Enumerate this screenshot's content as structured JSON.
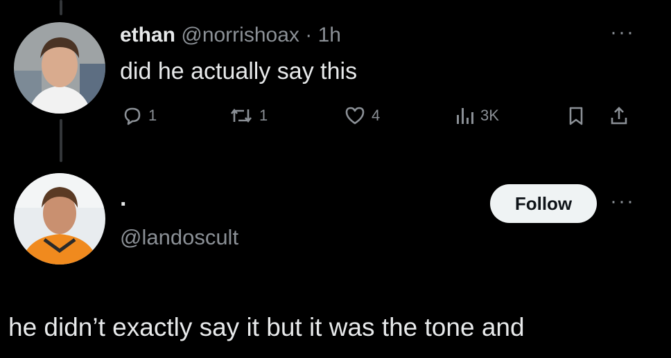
{
  "tweet": {
    "display_name": "ethan",
    "handle": "@norrishoax",
    "separator": " · ",
    "time": "1h",
    "text": "did he actually say this",
    "actions": {
      "reply_count": "1",
      "retweet_count": "1",
      "like_count": "4",
      "views_count": "3K"
    },
    "icons": [
      "reply-icon",
      "retweet-icon",
      "like-icon",
      "views-icon",
      "bookmark-icon",
      "share-icon"
    ]
  },
  "profile": {
    "display_name": "·",
    "handle": "@landoscult",
    "follow_label": "Follow"
  },
  "reply": {
    "text": "he didn’t exactly say it but it was the tone and"
  },
  "colors": {
    "background": "#000000",
    "primary_text": "#e7e9ea",
    "secondary_text": "#8b9096",
    "follow_bg": "#eff3f4",
    "follow_text": "#0f1419"
  }
}
